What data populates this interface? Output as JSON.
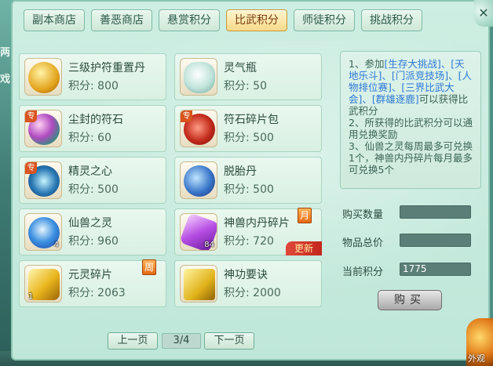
{
  "tabs": [
    {
      "label": "副本商店",
      "active": false
    },
    {
      "label": "善恶商店",
      "active": false
    },
    {
      "label": "悬赏积分",
      "active": false
    },
    {
      "label": "比武积分",
      "active": true
    },
    {
      "label": "师徒积分",
      "active": false
    },
    {
      "label": "挑战积分",
      "active": false
    }
  ],
  "items": [
    {
      "name": "三级护符重置丹",
      "price": "积分: 800",
      "icon": "gold-talisman-icon"
    },
    {
      "name": "灵气瓶",
      "price": "积分: 50",
      "icon": "vase-icon"
    },
    {
      "name": "尘封的符石",
      "price": "积分: 60",
      "icon": "gem-stone-icon",
      "badge": "专"
    },
    {
      "name": "符石碎片包",
      "price": "积分: 500",
      "icon": "red-bag-icon",
      "badge": "专"
    },
    {
      "name": "精灵之心",
      "price": "积分: 500",
      "icon": "spirit-heart-icon",
      "badge": "专"
    },
    {
      "name": "脱胎丹",
      "price": "积分: 500",
      "icon": "blue-pill-icon"
    },
    {
      "name": "仙兽之灵",
      "price": "积分: 960",
      "icon": "blue-orb-icon",
      "qty": "4"
    },
    {
      "name": "神兽内丹碎片",
      "price": "积分: 720",
      "icon": "purple-crystal-icon",
      "qty": "84",
      "tag": "月",
      "ribbon": "更新"
    },
    {
      "name": "元灵碎片",
      "price": "积分: 2063",
      "icon": "jade-fragment-icon",
      "qty": "1",
      "tag": "周"
    },
    {
      "name": "神功要诀",
      "price": "积分: 2000",
      "icon": "golden-book-icon"
    }
  ],
  "info": {
    "l1a": "1、参加",
    "l1b": "[生存大挑战]、[天地乐斗]、[门派竞技场]、[人物排位赛]、[三界比武大会]、[群雄逐鹿]",
    "l1c": "可以获得比武积分",
    "l2": "2、所获得的比武积分可以通用兑换奖励",
    "l3": "3、仙兽之灵每周最多可兑换1个，神兽内丹碎片每月最多可兑换5个"
  },
  "form": {
    "qty_label": "购买数量",
    "qty_value": "",
    "total_label": "物品总价",
    "total_value": "",
    "current_label": "当前积分",
    "current_value": "1775",
    "buy_label": "购买"
  },
  "pager": {
    "prev": "上一页",
    "page": "3/4",
    "next": "下一页"
  },
  "side": {
    "waiguan": "外观",
    "left_glyphs": [
      "两",
      "戏"
    ]
  }
}
